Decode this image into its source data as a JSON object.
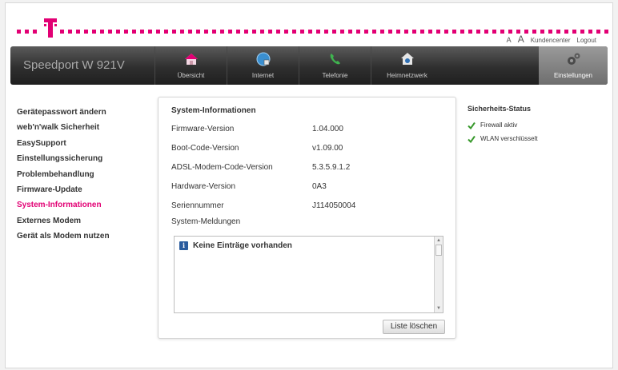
{
  "topnav": {
    "font_small": "A",
    "font_large": "A",
    "kundencenter": "Kundencenter",
    "logout": "Logout"
  },
  "brand": {
    "color": "#e20074"
  },
  "navbar": {
    "device": "Speedport W 921V",
    "items": [
      {
        "label": "Übersicht",
        "icon": "house-icon"
      },
      {
        "label": "Internet",
        "icon": "globe-icon"
      },
      {
        "label": "Telefonie",
        "icon": "phone-icon"
      },
      {
        "label": "Heimnetzwerk",
        "icon": "home-network-icon"
      }
    ],
    "active": {
      "label": "Einstellungen",
      "icon": "gears-icon"
    }
  },
  "sidebar": {
    "items": [
      {
        "label": "Gerätepasswort ändern"
      },
      {
        "label": "web'n'walk Sicherheit"
      },
      {
        "label": "EasySupport"
      },
      {
        "label": "Einstellungssicherung"
      },
      {
        "label": "Problembehandlung"
      },
      {
        "label": "Firmware-Update"
      },
      {
        "label": "System-Informationen"
      },
      {
        "label": "Externes Modem"
      },
      {
        "label": "Gerät als Modem nutzen"
      }
    ],
    "active_index": 6
  },
  "main": {
    "title": "System-Informationen",
    "rows": [
      {
        "label": "Firmware-Version",
        "value": "1.04.000"
      },
      {
        "label": "Boot-Code-Version",
        "value": "v1.09.00"
      },
      {
        "label": "ADSL-Modem-Code-Version",
        "value": "5.3.5.9.1.2"
      },
      {
        "label": "Hardware-Version",
        "value": "0A3"
      },
      {
        "label": "Seriennummer",
        "value": "J114050004"
      }
    ],
    "messages_heading": "System-Meldungen",
    "messages_empty": "Keine Einträge vorhanden",
    "clear_button": "Liste löschen"
  },
  "security": {
    "title": "Sicherheits-Status",
    "items": [
      {
        "label": "Firewall aktiv"
      },
      {
        "label": "WLAN verschlüsselt"
      }
    ]
  }
}
